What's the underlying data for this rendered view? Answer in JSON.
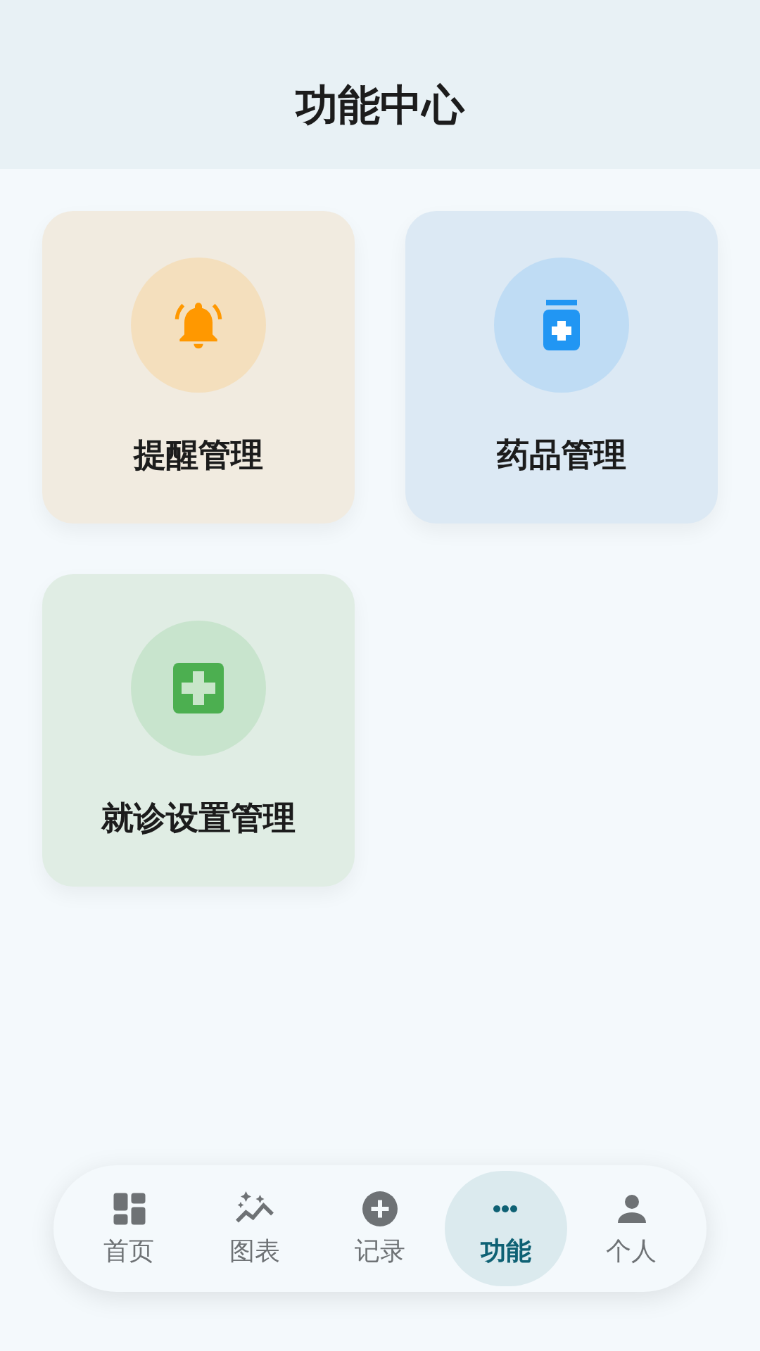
{
  "header": {
    "title": "功能中心"
  },
  "features": [
    {
      "kind": "reminder",
      "label": "提醒管理"
    },
    {
      "kind": "medicine",
      "label": "药品管理"
    },
    {
      "kind": "clinic",
      "label": "就诊设置管理"
    }
  ],
  "nav": [
    {
      "kind": "home",
      "label": "首页",
      "selected": false
    },
    {
      "kind": "chart",
      "label": "图表",
      "selected": false
    },
    {
      "kind": "record",
      "label": "记录",
      "selected": false
    },
    {
      "kind": "more",
      "label": "功能",
      "selected": true
    },
    {
      "kind": "person",
      "label": "个人",
      "selected": false
    }
  ]
}
